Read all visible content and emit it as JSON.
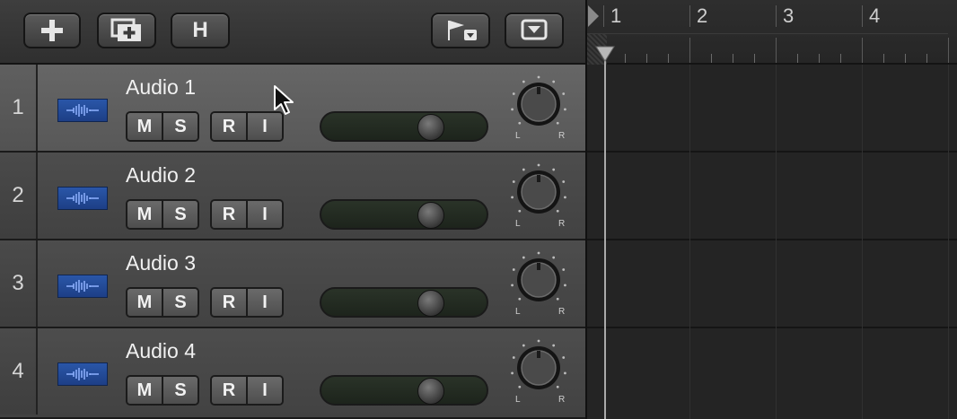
{
  "toolbar": {
    "add_track_icon": "plus-icon",
    "add_folder_icon": "folder-plus-icon",
    "hide_label": "H",
    "flag_icon": "flag-icon",
    "menu_icon": "chevron-down-icon"
  },
  "tracks": [
    {
      "number": "1",
      "name": "Audio 1",
      "mute": "M",
      "solo": "S",
      "record": "R",
      "input": "I",
      "volume": 0.7,
      "selected": true
    },
    {
      "number": "2",
      "name": "Audio 2",
      "mute": "M",
      "solo": "S",
      "record": "R",
      "input": "I",
      "volume": 0.7,
      "selected": false
    },
    {
      "number": "3",
      "name": "Audio 3",
      "mute": "M",
      "solo": "S",
      "record": "R",
      "input": "I",
      "volume": 0.7,
      "selected": false
    },
    {
      "number": "4",
      "name": "Audio 4",
      "mute": "M",
      "solo": "S",
      "record": "R",
      "input": "I",
      "volume": 0.7,
      "selected": false
    }
  ],
  "pan": {
    "left": "L",
    "right": "R"
  },
  "ruler": {
    "bars": [
      "1",
      "2",
      "3",
      "4"
    ]
  },
  "colors": {
    "region_icon": "#2a56a8",
    "selected_track": "#666666",
    "track": "#4d4d4d"
  }
}
